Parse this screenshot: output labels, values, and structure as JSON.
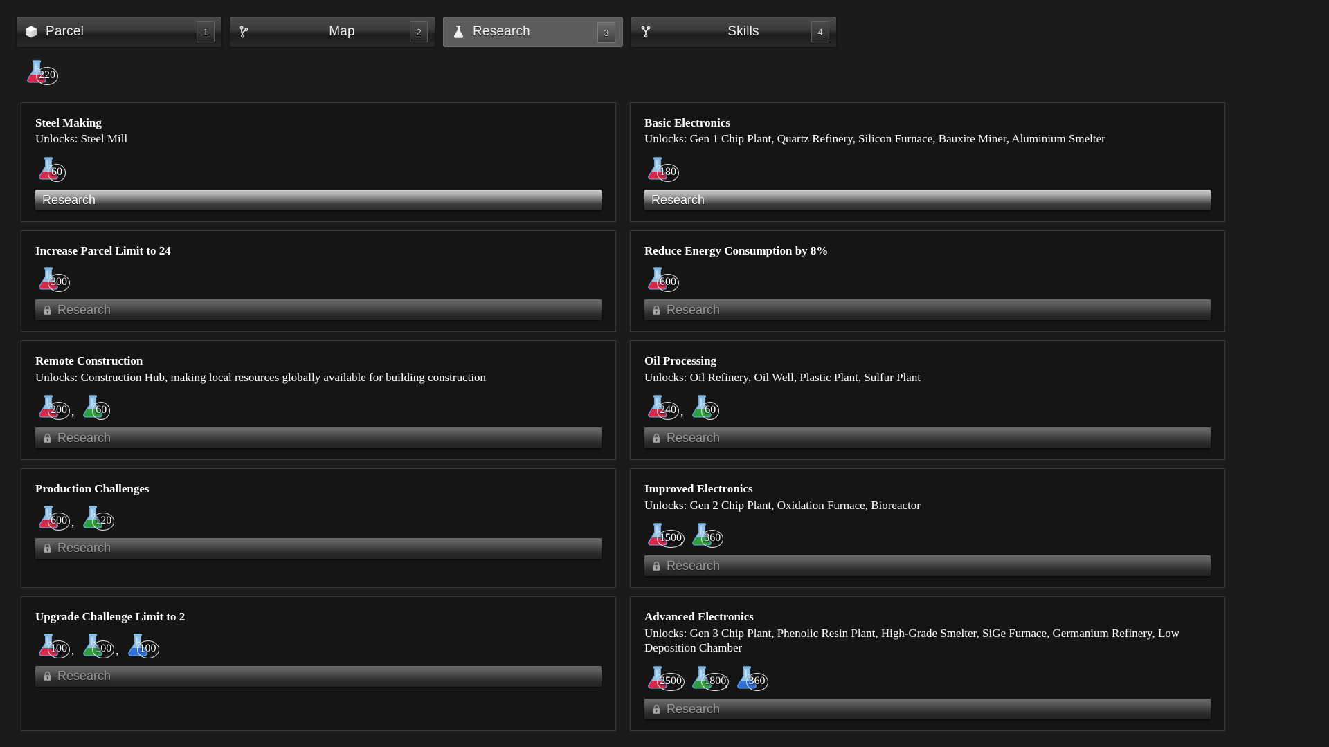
{
  "tabs": [
    {
      "label": "Parcel",
      "key": "1",
      "icon": "cube-icon",
      "active": false
    },
    {
      "label": "Map",
      "key": "2",
      "icon": "branch-icon",
      "active": false
    },
    {
      "label": "Research",
      "key": "3",
      "icon": "flask-icon",
      "active": true
    },
    {
      "label": "Skills",
      "key": "4",
      "icon": "skilltree-icon",
      "active": false
    }
  ],
  "resources": [
    {
      "type": "red",
      "amount": "220"
    }
  ],
  "button_labels": {
    "research": "Research",
    "separator": ","
  },
  "colors": {
    "flask_red": "#d6294a",
    "flask_green": "#2f9e3f",
    "flask_blue": "#2f6fd6",
    "flask_glass": "#9fd0f5",
    "page_bg": "#1b1b1b",
    "card_bg": "#151515",
    "card_border": "#3a3a3a",
    "accent_text": "#ffffff"
  },
  "cards": [
    {
      "title": "Steel Making",
      "unlocks": "Unlocks: Steel Mill",
      "costs": [
        {
          "type": "red",
          "amount": "60"
        }
      ],
      "locked": false
    },
    {
      "title": "Basic Electronics",
      "unlocks": "Unlocks: Gen 1 Chip Plant, Quartz Refinery, Silicon Furnace, Bauxite Miner, Aluminium Smelter",
      "costs": [
        {
          "type": "red",
          "amount": "180"
        }
      ],
      "locked": false
    },
    {
      "title": "Increase Parcel Limit to 24",
      "unlocks": "",
      "costs": [
        {
          "type": "red",
          "amount": "300"
        }
      ],
      "locked": true
    },
    {
      "title": "Reduce Energy Consumption by 8%",
      "unlocks": "",
      "costs": [
        {
          "type": "red",
          "amount": "600"
        }
      ],
      "locked": true
    },
    {
      "title": "Remote Construction",
      "unlocks": "Unlocks: Construction Hub, making local resources globally available for building construction",
      "costs": [
        {
          "type": "red",
          "amount": "200"
        },
        {
          "type": "green",
          "amount": "60"
        }
      ],
      "locked": true
    },
    {
      "title": "Oil Processing",
      "unlocks": "Unlocks: Oil Refinery, Oil Well, Plastic Plant, Sulfur Plant",
      "costs": [
        {
          "type": "red",
          "amount": "240"
        },
        {
          "type": "green",
          "amount": "60"
        }
      ],
      "locked": true
    },
    {
      "title": "Production Challenges",
      "unlocks": "",
      "costs": [
        {
          "type": "red",
          "amount": "600"
        },
        {
          "type": "green",
          "amount": "120"
        }
      ],
      "locked": true
    },
    {
      "title": "Improved Electronics",
      "unlocks": "Unlocks: Gen 2 Chip Plant, Oxidation Furnace, Bioreactor",
      "costs": [
        {
          "type": "red",
          "amount": "1500"
        },
        {
          "type": "green",
          "amount": "360"
        }
      ],
      "locked": true
    },
    {
      "title": "Upgrade Challenge Limit to 2",
      "unlocks": "",
      "costs": [
        {
          "type": "red",
          "amount": "100"
        },
        {
          "type": "green",
          "amount": "100"
        },
        {
          "type": "blue",
          "amount": "100"
        }
      ],
      "locked": true
    },
    {
      "title": "Advanced Electronics",
      "unlocks": "Unlocks: Gen 3 Chip Plant, Phenolic Resin Plant, High-Grade Smelter, SiGe Furnace, Germanium Refinery, Low Deposition Chamber",
      "costs": [
        {
          "type": "red",
          "amount": "2500"
        },
        {
          "type": "green",
          "amount": "1800"
        },
        {
          "type": "blue",
          "amount": "360"
        }
      ],
      "locked": true
    }
  ]
}
